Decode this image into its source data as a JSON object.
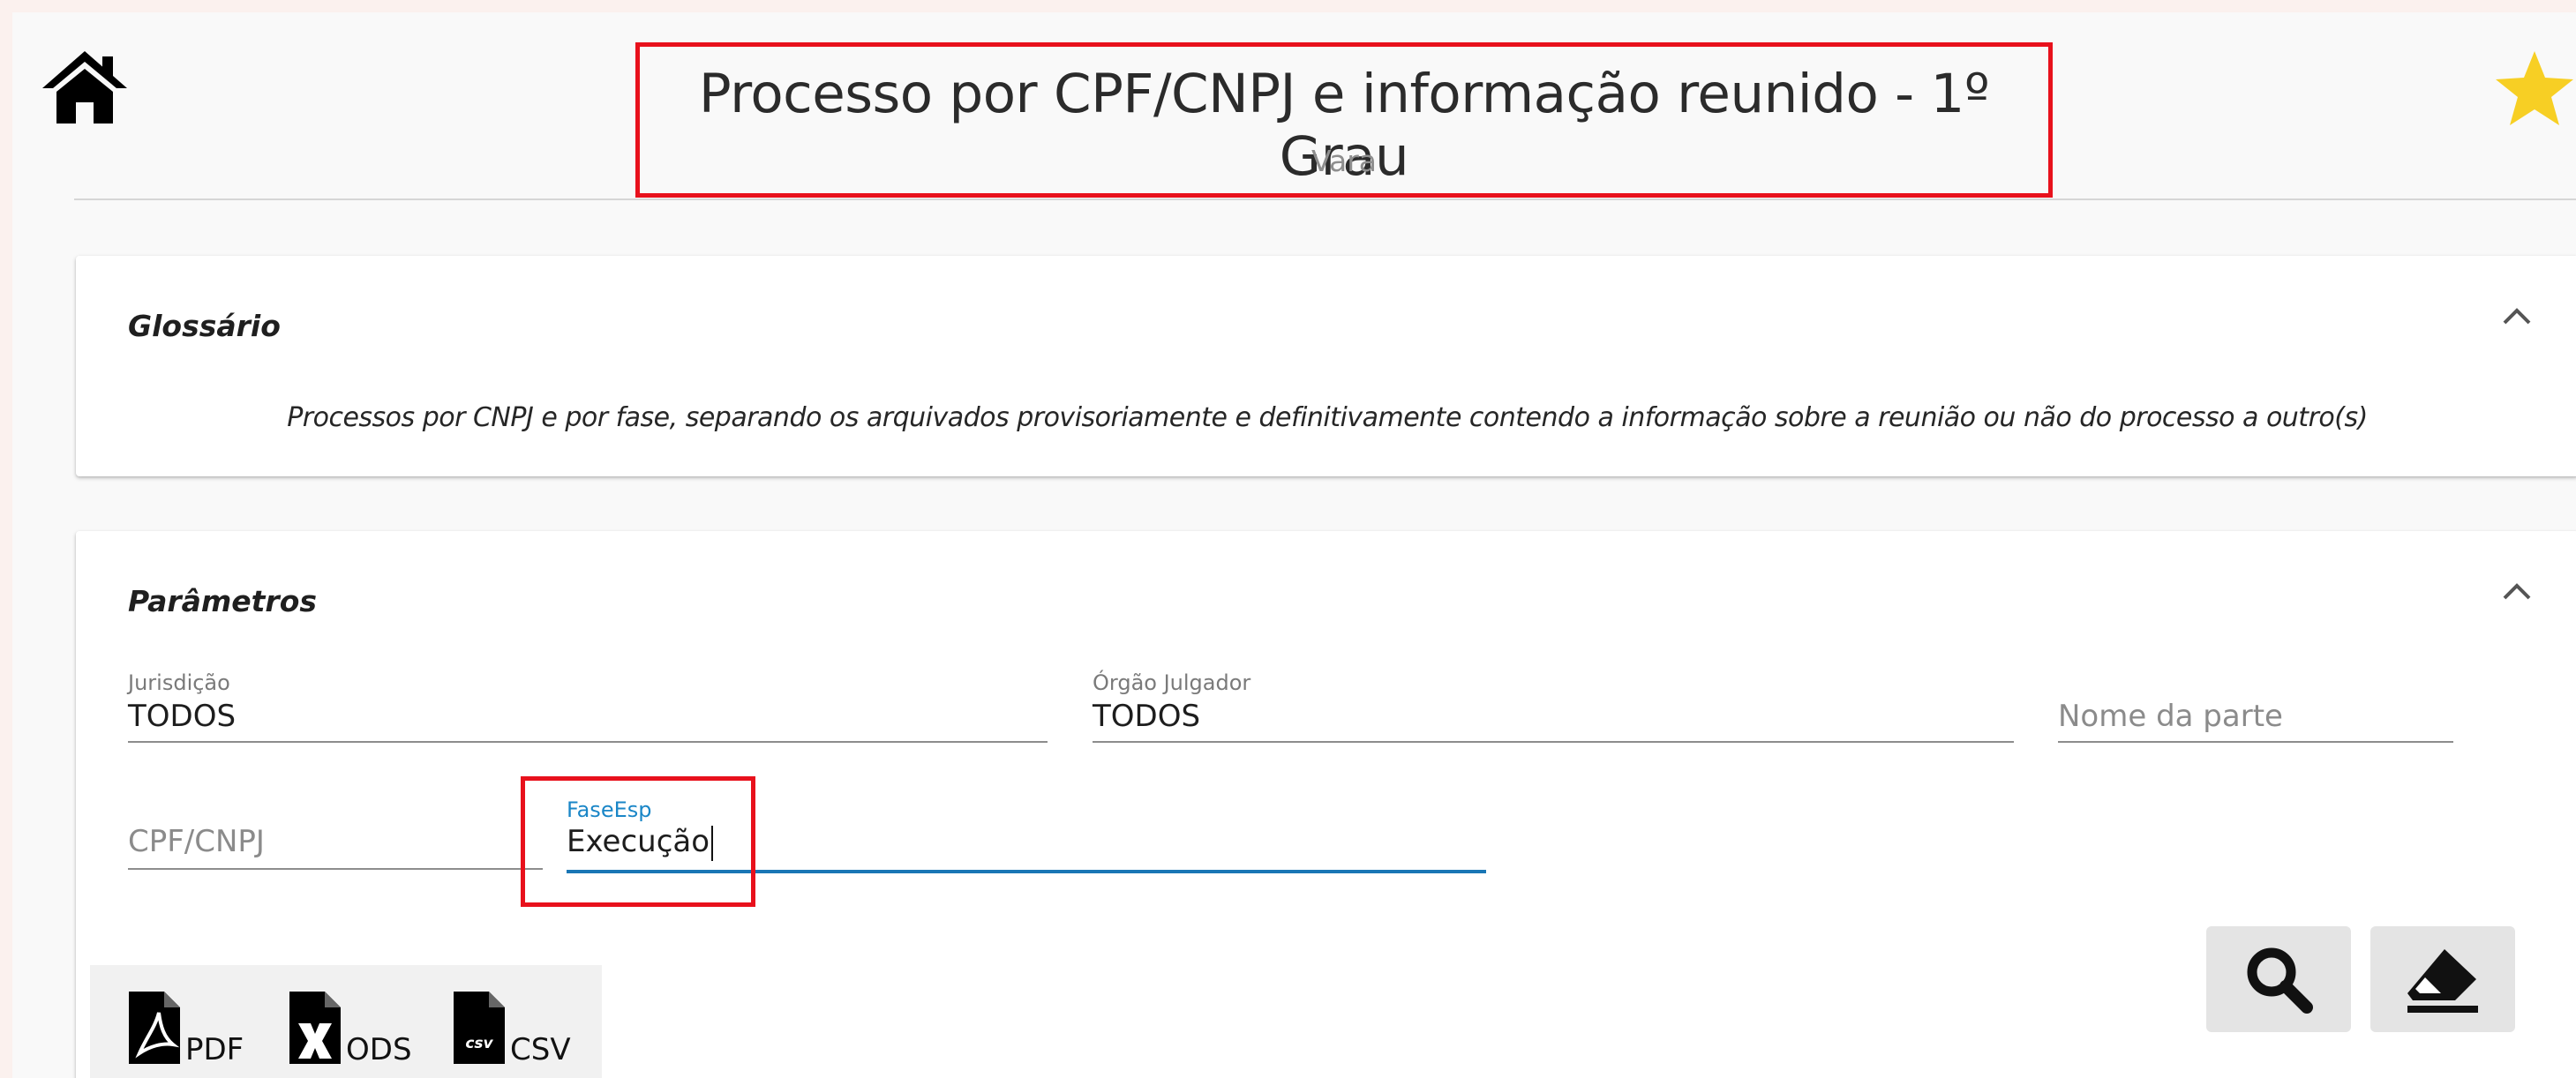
{
  "header": {
    "title": "Processo por CPF/CNPJ e informação reunido - 1º Grau",
    "subtitle": "Vara",
    "home_icon": "home-icon",
    "favorite_icon": "star-icon"
  },
  "glossario": {
    "title": "Glossário",
    "text": "Processos por CNPJ e por fase, separando os arquivados provisoriamente e definitivamente contendo a informação sobre a reunião ou não do processo a outro(s)"
  },
  "parametros": {
    "title": "Parâmetros",
    "fields": {
      "jurisdicao": {
        "label": "Jurisdição",
        "value": "TODOS"
      },
      "orgao_julgador": {
        "label": "Órgão Julgador",
        "value": "TODOS"
      },
      "nome_parte": {
        "placeholder": "Nome da parte"
      },
      "cpf_cnpj": {
        "placeholder": "CPF/CNPJ"
      },
      "fase_esp": {
        "label": "FaseEsp",
        "value": "Execução"
      }
    }
  },
  "export": {
    "pdf": "PDF",
    "ods": "ODS",
    "csv": "CSV",
    "csv_icon_text": "csv"
  },
  "actions": {
    "search_icon": "search-icon",
    "clear_icon": "eraser-icon"
  },
  "colors": {
    "highlight": "#e8111c",
    "focus": "#1976b5",
    "star": "#f7cf24"
  }
}
